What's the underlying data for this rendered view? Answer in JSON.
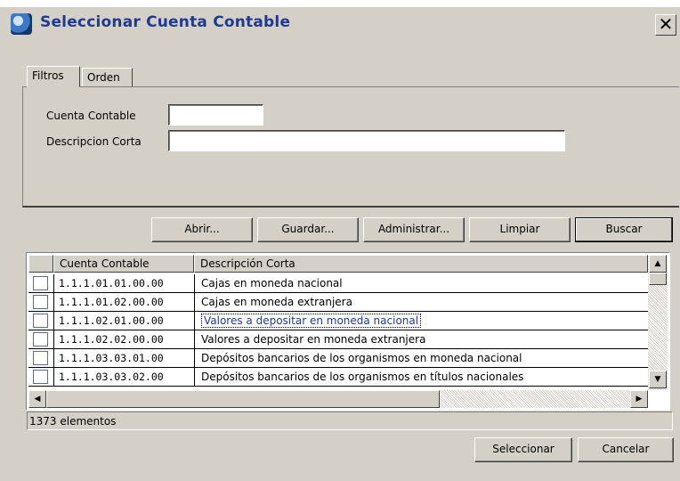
{
  "window": {
    "title": "Seleccionar Cuenta Contable",
    "close_label": "✕"
  },
  "tabs": [
    {
      "label": "Filtros"
    },
    {
      "label": "Orden"
    }
  ],
  "filters": {
    "cuenta_label": "Cuenta Contable",
    "cuenta_value": "",
    "descripcion_label": "Descripcion Corta",
    "descripcion_value": ""
  },
  "toolbar": {
    "abrir": "Abrir...",
    "guardar": "Guardar...",
    "administrar": "Administrar...",
    "limpiar": "Limpiar",
    "buscar": "Buscar"
  },
  "table": {
    "columns": [
      "Cuenta Contable",
      "Descripción Corta"
    ],
    "rows": [
      [
        "1.1.1.01.01.00.00",
        "Cajas en moneda nacional"
      ],
      [
        "1.1.1.01.02.00.00",
        "Cajas en moneda extranjera"
      ],
      [
        "1.1.1.02.01.00.00",
        "Valores a depositar en moneda nacional"
      ],
      [
        "1.1.1.02.02.00.00",
        "Valores a depositar en moneda extranjera"
      ],
      [
        "1.1.1.03.03.01.00",
        "Depósitos bancarios de los organismos en moneda nacional"
      ],
      [
        "1.1.1.03.03.02.00",
        "Depósitos bancarios de los organismos en títulos nacionales"
      ]
    ]
  },
  "status": {
    "count": "1373 elementos"
  },
  "footer": {
    "seleccionar": "Seleccionar",
    "cancelar": "Cancelar"
  },
  "icons": {
    "app": "app-logo-icon",
    "close": "close-icon",
    "up": "scroll-up-icon",
    "down": "scroll-down-icon",
    "left": "scroll-left-icon",
    "right": "scroll-right-icon"
  }
}
